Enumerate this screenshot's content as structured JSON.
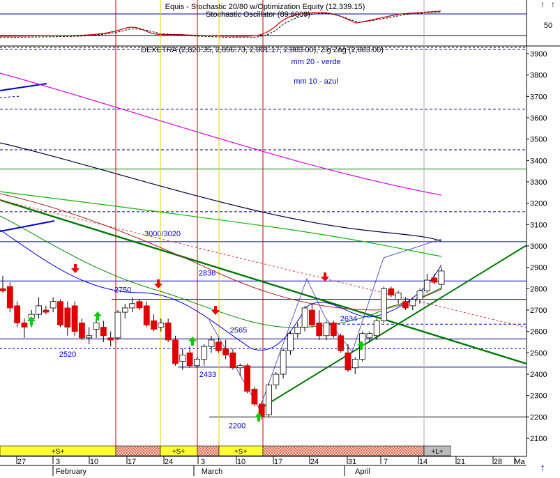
{
  "window": {
    "corner_arrows": [
      "↑",
      "↑"
    ],
    "bottom_arrow": "↑"
  },
  "oscillator_panel": {
    "title": "Equis - Stochastic 20/80  w/Optimization Equity (12,339.15)",
    "subtitle": "Stochastic Oscillator (89.6009)",
    "ticks": [
      50
    ]
  },
  "price_panel": {
    "title": "DEXETRA (2,820.35, 2,896.73, 2,801.17, 2,883.00), Zig Zag (2,883.00)",
    "legend_mm20": "mm 20 - verde",
    "legend_mm10": "mm 10 - azul",
    "ticks": [
      3900,
      3800,
      3700,
      3600,
      3500,
      3400,
      3300,
      3200,
      3100,
      3000,
      2900,
      2800,
      2700,
      2600,
      2500,
      2400,
      2300,
      2200,
      2100
    ]
  },
  "chart_data": {
    "type": "candlestick",
    "ylim": [
      2050,
      3960
    ],
    "grid": false,
    "x_labels": [
      "27",
      "3",
      "10",
      "17",
      "24",
      "3",
      "10",
      "17",
      "24",
      "31",
      "7",
      "14",
      "21",
      "28",
      "Ma"
    ],
    "month_labels": [
      "February",
      "March",
      "April"
    ],
    "horizontal_levels": [
      {
        "label": "3000/3020",
        "value": 3020
      },
      {
        "label": "2836",
        "value": 2836
      },
      {
        "label": "2750",
        "value": 2750
      },
      {
        "label": "2634",
        "value": 2634
      },
      {
        "label": "2565",
        "value": 2565
      },
      {
        "label": "2520",
        "value": 2520
      },
      {
        "label": "2433",
        "value": 2433
      },
      {
        "label": "2200",
        "value": 2200
      }
    ],
    "dashed_levels": [
      3920,
      3640,
      3450,
      3160
    ],
    "green_levels": [
      3360
    ],
    "candles": [
      {
        "o": 2800,
        "h": 2860,
        "l": 2780,
        "c": 2790
      },
      {
        "o": 2810,
        "h": 2830,
        "l": 2690,
        "c": 2710
      },
      {
        "o": 2720,
        "h": 2740,
        "l": 2620,
        "c": 2640
      },
      {
        "o": 2640,
        "h": 2660,
        "l": 2570,
        "c": 2620
      },
      {
        "o": 2660,
        "h": 2700,
        "l": 2620,
        "c": 2680
      },
      {
        "o": 2680,
        "h": 2760,
        "l": 2660,
        "c": 2720
      },
      {
        "o": 2700,
        "h": 2720,
        "l": 2680,
        "c": 2690
      },
      {
        "o": 2710,
        "h": 2760,
        "l": 2690,
        "c": 2740
      },
      {
        "o": 2740,
        "h": 2750,
        "l": 2620,
        "c": 2630
      },
      {
        "o": 2710,
        "h": 2740,
        "l": 2580,
        "c": 2620
      },
      {
        "o": 2720,
        "h": 2740,
        "l": 2580,
        "c": 2600
      },
      {
        "o": 2640,
        "h": 2660,
        "l": 2560,
        "c": 2570
      },
      {
        "o": 2570,
        "h": 2620,
        "l": 2540,
        "c": 2580
      },
      {
        "o": 2610,
        "h": 2660,
        "l": 2570,
        "c": 2640
      },
      {
        "o": 2620,
        "h": 2650,
        "l": 2550,
        "c": 2580
      },
      {
        "o": 2570,
        "h": 2600,
        "l": 2530,
        "c": 2560
      },
      {
        "o": 2570,
        "h": 2700,
        "l": 2560,
        "c": 2690
      },
      {
        "o": 2690,
        "h": 2730,
        "l": 2660,
        "c": 2710
      },
      {
        "o": 2710,
        "h": 2760,
        "l": 2690,
        "c": 2730
      },
      {
        "o": 2740,
        "h": 2750,
        "l": 2700,
        "c": 2710
      },
      {
        "o": 2720,
        "h": 2740,
        "l": 2620,
        "c": 2630
      },
      {
        "o": 2650,
        "h": 2680,
        "l": 2600,
        "c": 2610
      },
      {
        "o": 2620,
        "h": 2660,
        "l": 2600,
        "c": 2640
      },
      {
        "o": 2640,
        "h": 2660,
        "l": 2550,
        "c": 2560
      },
      {
        "o": 2560,
        "h": 2580,
        "l": 2440,
        "c": 2450
      },
      {
        "o": 2460,
        "h": 2520,
        "l": 2420,
        "c": 2490
      },
      {
        "o": 2500,
        "h": 2530,
        "l": 2430,
        "c": 2440
      },
      {
        "o": 2440,
        "h": 2480,
        "l": 2430,
        "c": 2470
      },
      {
        "o": 2470,
        "h": 2540,
        "l": 2440,
        "c": 2530
      },
      {
        "o": 2530,
        "h": 2580,
        "l": 2500,
        "c": 2560
      },
      {
        "o": 2550,
        "h": 2570,
        "l": 2500,
        "c": 2510
      },
      {
        "o": 2520,
        "h": 2560,
        "l": 2470,
        "c": 2490
      },
      {
        "o": 2500,
        "h": 2520,
        "l": 2420,
        "c": 2430
      },
      {
        "o": 2430,
        "h": 2450,
        "l": 2390,
        "c": 2440
      },
      {
        "o": 2440,
        "h": 2450,
        "l": 2310,
        "c": 2320
      },
      {
        "o": 2330,
        "h": 2340,
        "l": 2250,
        "c": 2260
      },
      {
        "o": 2260,
        "h": 2270,
        "l": 2190,
        "c": 2200
      },
      {
        "o": 2210,
        "h": 2360,
        "l": 2200,
        "c": 2350
      },
      {
        "o": 2350,
        "h": 2410,
        "l": 2330,
        "c": 2400
      },
      {
        "o": 2400,
        "h": 2520,
        "l": 2380,
        "c": 2510
      },
      {
        "o": 2510,
        "h": 2600,
        "l": 2490,
        "c": 2590
      },
      {
        "o": 2590,
        "h": 2640,
        "l": 2570,
        "c": 2620
      },
      {
        "o": 2620,
        "h": 2720,
        "l": 2600,
        "c": 2710
      },
      {
        "o": 2700,
        "h": 2730,
        "l": 2620,
        "c": 2630
      },
      {
        "o": 2640,
        "h": 2700,
        "l": 2560,
        "c": 2580
      },
      {
        "o": 2580,
        "h": 2650,
        "l": 2560,
        "c": 2640
      },
      {
        "o": 2640,
        "h": 2650,
        "l": 2570,
        "c": 2580
      },
      {
        "o": 2580,
        "h": 2590,
        "l": 2500,
        "c": 2510
      },
      {
        "o": 2500,
        "h": 2540,
        "l": 2410,
        "c": 2420
      },
      {
        "o": 2430,
        "h": 2480,
        "l": 2400,
        "c": 2470
      },
      {
        "o": 2470,
        "h": 2600,
        "l": 2460,
        "c": 2590
      },
      {
        "o": 2570,
        "h": 2600,
        "l": 2550,
        "c": 2590
      },
      {
        "o": 2580,
        "h": 2660,
        "l": 2560,
        "c": 2650
      },
      {
        "o": 2650,
        "h": 2810,
        "l": 2640,
        "c": 2800
      },
      {
        "o": 2800,
        "h": 2810,
        "l": 2760,
        "c": 2770
      },
      {
        "o": 2750,
        "h": 2790,
        "l": 2730,
        "c": 2780
      },
      {
        "o": 2740,
        "h": 2760,
        "l": 2700,
        "c": 2710
      },
      {
        "o": 2720,
        "h": 2760,
        "l": 2700,
        "c": 2750
      },
      {
        "o": 2750,
        "h": 2800,
        "l": 2730,
        "c": 2790
      },
      {
        "o": 2790,
        "h": 2870,
        "l": 2780,
        "c": 2840
      },
      {
        "o": 2850,
        "h": 2870,
        "l": 2820,
        "c": 2830
      },
      {
        "o": 2820,
        "h": 2900,
        "l": 2800,
        "c": 2883
      }
    ],
    "bullish_color": "#ffffff",
    "bearish_color": "#e00000",
    "signal_bar": [
      "+S+",
      "+S+",
      "+S+",
      "+L+"
    ]
  }
}
